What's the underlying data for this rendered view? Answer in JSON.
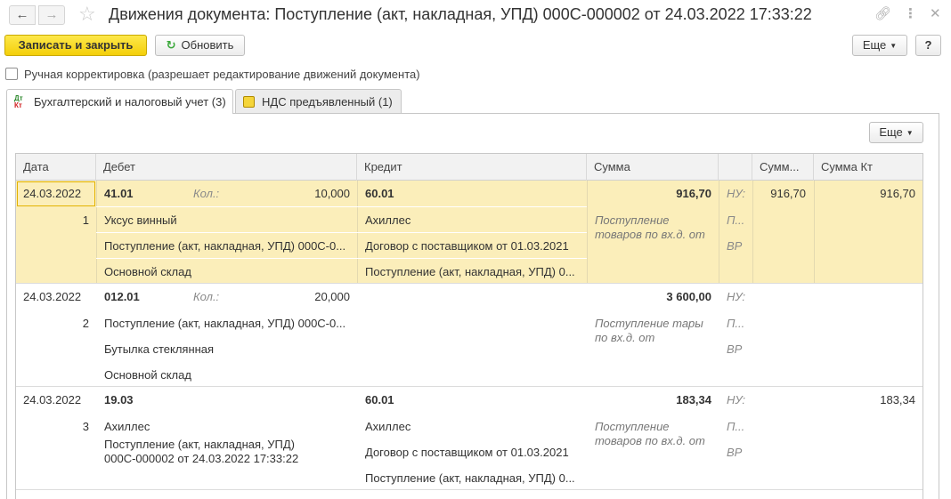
{
  "window": {
    "title": "Движения документа: Поступление (акт, накладная, УПД) 000С-000002 от 24.03.2022 17:33:22",
    "icons": [
      "back-arrow-icon",
      "forward-arrow-icon",
      "star-icon",
      "link-icon",
      "more-icon",
      "close-icon"
    ]
  },
  "toolbar": {
    "save_close": "Записать и закрыть",
    "refresh": "Обновить",
    "more": "Еще",
    "help": "?"
  },
  "manual_edit": {
    "label": "Ручная корректировка (разрешает редактирование движений документа)",
    "checked": false
  },
  "tabs": [
    {
      "label": "Бухгалтерский и налоговый учет (3)",
      "active": true
    },
    {
      "label": "НДС предъявленный (1)",
      "active": false
    }
  ],
  "grid": {
    "more": "Еще",
    "columns": [
      "Дата",
      "Дебет",
      "Кредит",
      "Сумма",
      "",
      "Сумм...",
      "Сумма Кт"
    ],
    "records": [
      {
        "date": "24.03.2022",
        "num": "1",
        "debit_account": "41.01",
        "qty_label": "Кол.:",
        "qty": "10,000",
        "debit_lines": [
          "Уксус винный",
          "Поступление (акт, накладная, УПД) 000С-0...",
          "Основной склад"
        ],
        "credit_account": "60.01",
        "credit_lines": [
          "Ахиллес",
          "Договор с поставщиком от 01.03.2021",
          "Поступление (акт, накладная, УПД) 0..."
        ],
        "sum": "916,70",
        "content": "Поступление товаров по вх.д.  от",
        "flags": [
          "НУ:",
          "П...",
          "ВР"
        ],
        "sum_dt": "916,70",
        "sum_kt": "916,70"
      },
      {
        "date": "24.03.2022",
        "num": "2",
        "debit_account": "012.01",
        "qty_label": "Кол.:",
        "qty": "20,000",
        "debit_lines": [
          "Поступление (акт, накладная, УПД) 000С-0...",
          "Бутылка стеклянная",
          "Основной склад"
        ],
        "credit_account": "",
        "credit_lines": [
          "",
          "",
          ""
        ],
        "sum": "3 600,00",
        "content": "Поступление тары по вх.д.  от",
        "flags": [
          "НУ:",
          "П...",
          "ВР"
        ],
        "sum_dt": "",
        "sum_kt": ""
      },
      {
        "date": "24.03.2022",
        "num": "3",
        "debit_account": "19.03",
        "qty_label": "",
        "qty": "",
        "debit_lines": [
          "Ахиллес",
          "Поступление (акт, накладная, УПД)",
          "000С-000002 от 24.03.2022 17:33:22"
        ],
        "credit_account": "60.01",
        "credit_lines": [
          "Ахиллес",
          "Договор с поставщиком от 01.03.2021",
          "Поступление (акт, накладная, УПД) 0..."
        ],
        "sum": "183,34",
        "content": "Поступление товаров по вх.д.  от",
        "flags": [
          "НУ:",
          "П...",
          "ВР"
        ],
        "sum_dt": "",
        "sum_kt": "183,34"
      }
    ]
  }
}
